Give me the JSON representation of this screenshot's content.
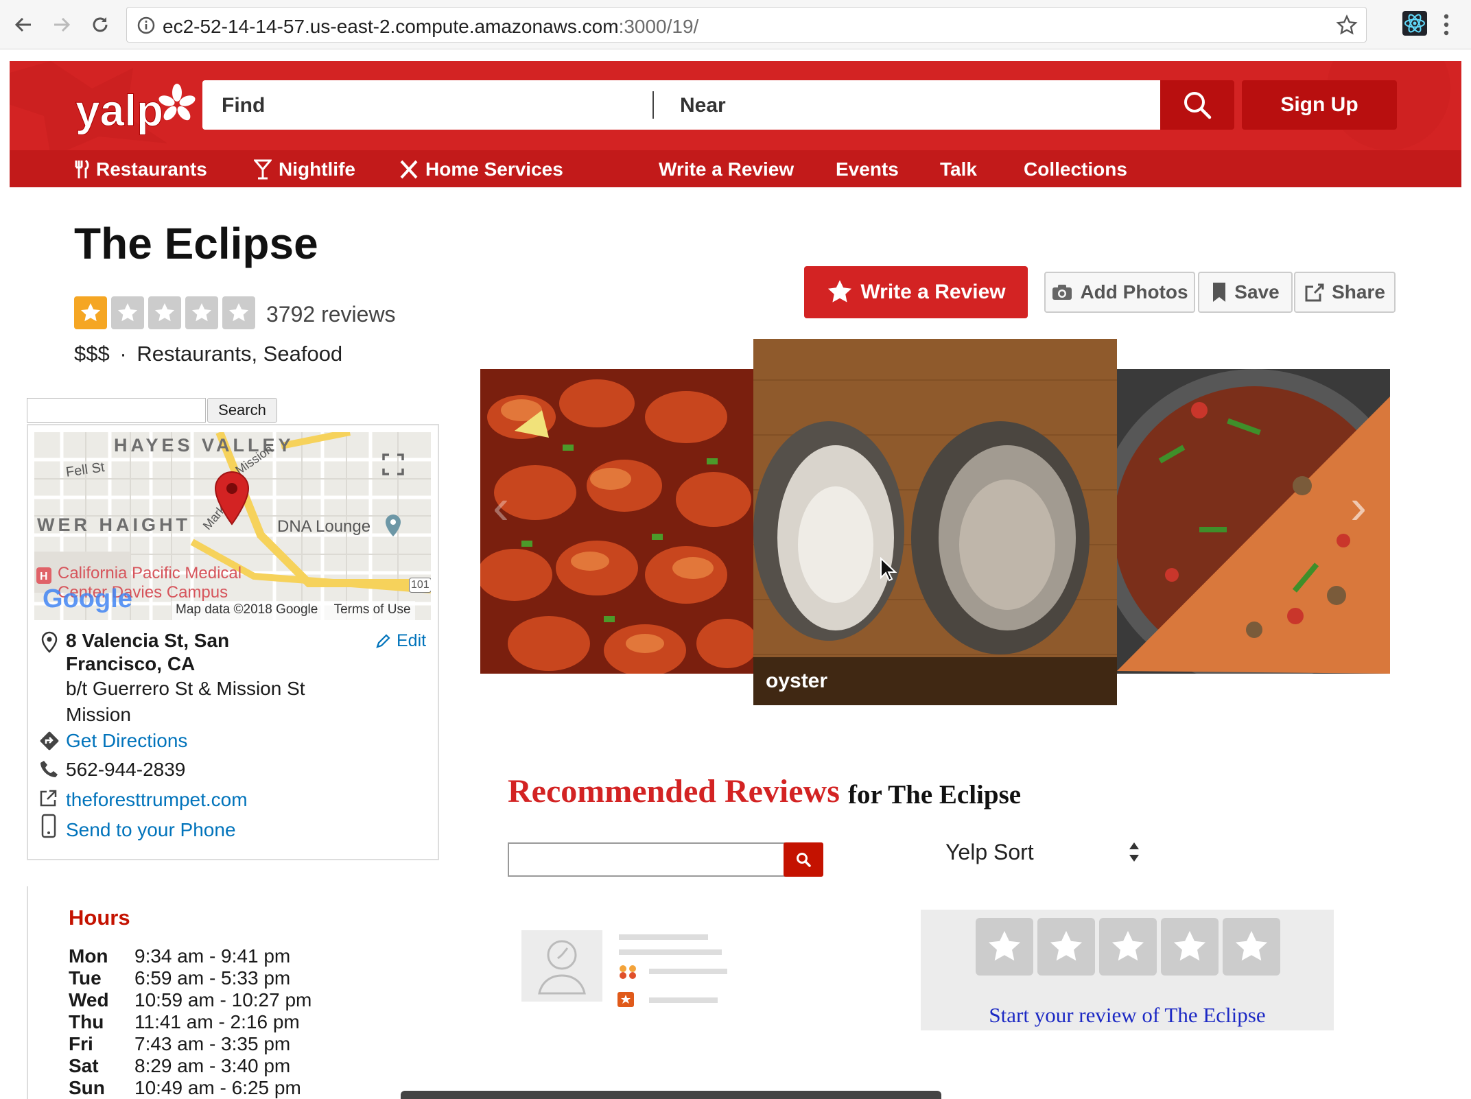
{
  "browser": {
    "url_host": "ec2-52-14-14-57.us-east-2.compute.amazonaws.com",
    "url_rest": ":3000/19/"
  },
  "header": {
    "find_label": "Find",
    "near_label": "Near",
    "signup_label": "Sign Up",
    "nav": {
      "restaurants": "Restaurants",
      "nightlife": "Nightlife",
      "home_services": "Home Services",
      "write_review": "Write a Review",
      "events": "Events",
      "talk": "Talk",
      "collections": "Collections"
    }
  },
  "business": {
    "name": "The Eclipse",
    "rating": 1,
    "rating_max": 5,
    "review_count": "3792 reviews",
    "price": "$$$",
    "separator": "·",
    "categories": "Restaurants, Seafood"
  },
  "actions": {
    "write_review": "Write a Review",
    "add_photos": "Add Photos",
    "save": "Save",
    "share": "Share"
  },
  "map_panel": {
    "search_button": "Search",
    "labels": {
      "hayes_valley": "HAYES VALLEY",
      "fell_st": "Fell St",
      "lower_haight": "WER HAIGHT",
      "market_st": "Market St",
      "mission": "Mission",
      "dna_lounge": "DNA Lounge",
      "hospital": "California Pacific Medical",
      "hospital2": "Center Davies Campus",
      "google": "Google",
      "map_data": "Map data ©2018 Google",
      "terms": "Terms of Use",
      "route": "101"
    }
  },
  "contact": {
    "address_line1": "8 Valencia St, San",
    "address_line2": "Francisco, CA",
    "cross_streets": "b/t Guerrero St & Mission St",
    "neighborhood": "Mission",
    "edit": "Edit",
    "directions": "Get Directions",
    "phone": "562-944-2839",
    "website": "theforesttrumpet.com",
    "send_phone": "Send to your Phone"
  },
  "hours": {
    "title": "Hours",
    "rows": [
      {
        "day": "Mon",
        "time": "9:34 am - 9:41 pm"
      },
      {
        "day": "Tue",
        "time": "6:59 am - 5:33 pm"
      },
      {
        "day": "Wed",
        "time": "10:59 am - 10:27 pm"
      },
      {
        "day": "Thu",
        "time": "11:41 am - 2:16 pm"
      },
      {
        "day": "Fri",
        "time": "7:43 am - 3:35 pm"
      },
      {
        "day": "Sat",
        "time": "8:29 am - 3:40 pm"
      },
      {
        "day": "Sun",
        "time": "10:49 am - 6:25 pm"
      }
    ]
  },
  "photos": {
    "caption": "oyster",
    "prev_arrow": "‹",
    "next_arrow": "›"
  },
  "reviews": {
    "heading": "Recommended Reviews",
    "heading_for": "for The Eclipse",
    "sort_label": "Yelp Sort",
    "start_review": "Start your review of The Eclipse"
  },
  "colors": {
    "brand_red": "#d32323",
    "link_blue": "#0073bb",
    "star_orange": "#f5a623"
  }
}
